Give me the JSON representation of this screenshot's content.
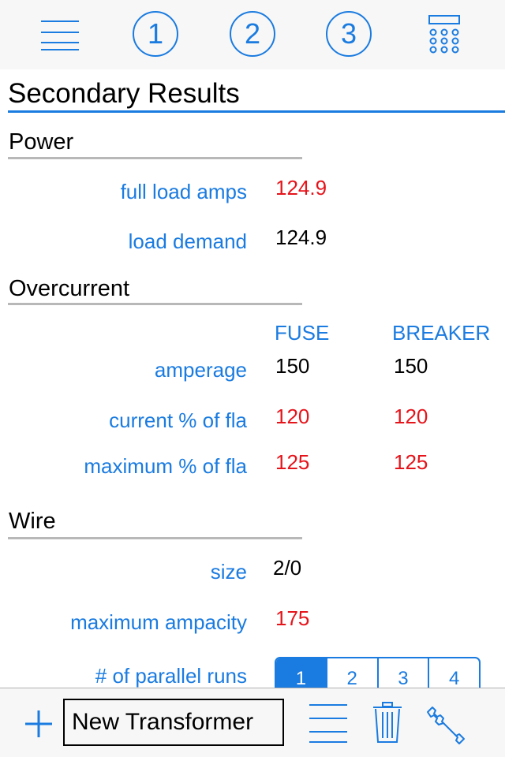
{
  "nav": {
    "steps": [
      "1",
      "2",
      "3"
    ],
    "icons": [
      "menu-icon",
      "step-1-icon",
      "step-2-icon",
      "step-3-icon",
      "calculator-icon"
    ]
  },
  "title": "Secondary Results",
  "power": {
    "heading": "Power",
    "rows": [
      {
        "label": "full load amps",
        "value": "124.9",
        "color": "red"
      },
      {
        "label": "load demand",
        "value": "124.9",
        "color": "black"
      }
    ]
  },
  "overcurrent": {
    "heading": "Overcurrent",
    "columns": [
      "FUSE",
      "BREAKER"
    ],
    "rows": [
      {
        "label": "amperage",
        "fuse": "150",
        "breaker": "150",
        "color": "black"
      },
      {
        "label": "current % of fla",
        "fuse": "120",
        "breaker": "120",
        "color": "red"
      },
      {
        "label": "maximum % of fla",
        "fuse": "125",
        "breaker": "125",
        "color": "red"
      }
    ]
  },
  "wire": {
    "heading": "Wire",
    "rows": [
      {
        "label": "size",
        "value": "2/0",
        "color": "black"
      },
      {
        "label": "maximum ampacity",
        "value": "175",
        "color": "red"
      }
    ],
    "parallel": {
      "label": "# of parallel runs",
      "options": [
        "1",
        "2",
        "3",
        "4"
      ],
      "selected": "1"
    }
  },
  "toolbar": {
    "name_value": "New Transformer"
  },
  "colors": {
    "accent": "#1a7be0",
    "warning": "#e5141b"
  }
}
